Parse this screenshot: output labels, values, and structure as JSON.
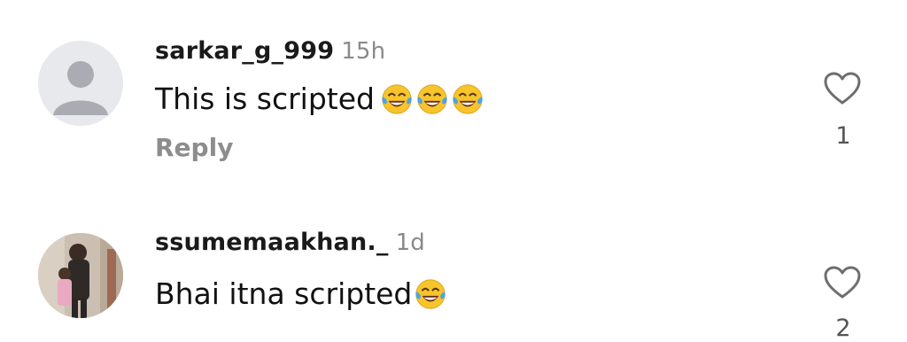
{
  "comments": [
    {
      "username": "sarkar_g_999",
      "time": "15h",
      "text": "This is scripted",
      "emojis": [
        "face-with-tears-of-joy",
        "face-with-tears-of-joy",
        "face-with-tears-of-joy"
      ],
      "reply_label": "Reply",
      "like_count": "1",
      "avatar": "default-avatar-icon"
    },
    {
      "username": "ssumemaakhan._",
      "time": "1d",
      "text": "Bhai itna scripted",
      "emojis": [
        "face-with-tears-of-joy"
      ],
      "like_count": "2",
      "avatar": "user-photo"
    }
  ],
  "colors": {
    "username": "#1a1a1a",
    "timestamp": "#8a8a8a",
    "reply": "#8d8d8d",
    "heart_outline": "#6e6e6e"
  }
}
